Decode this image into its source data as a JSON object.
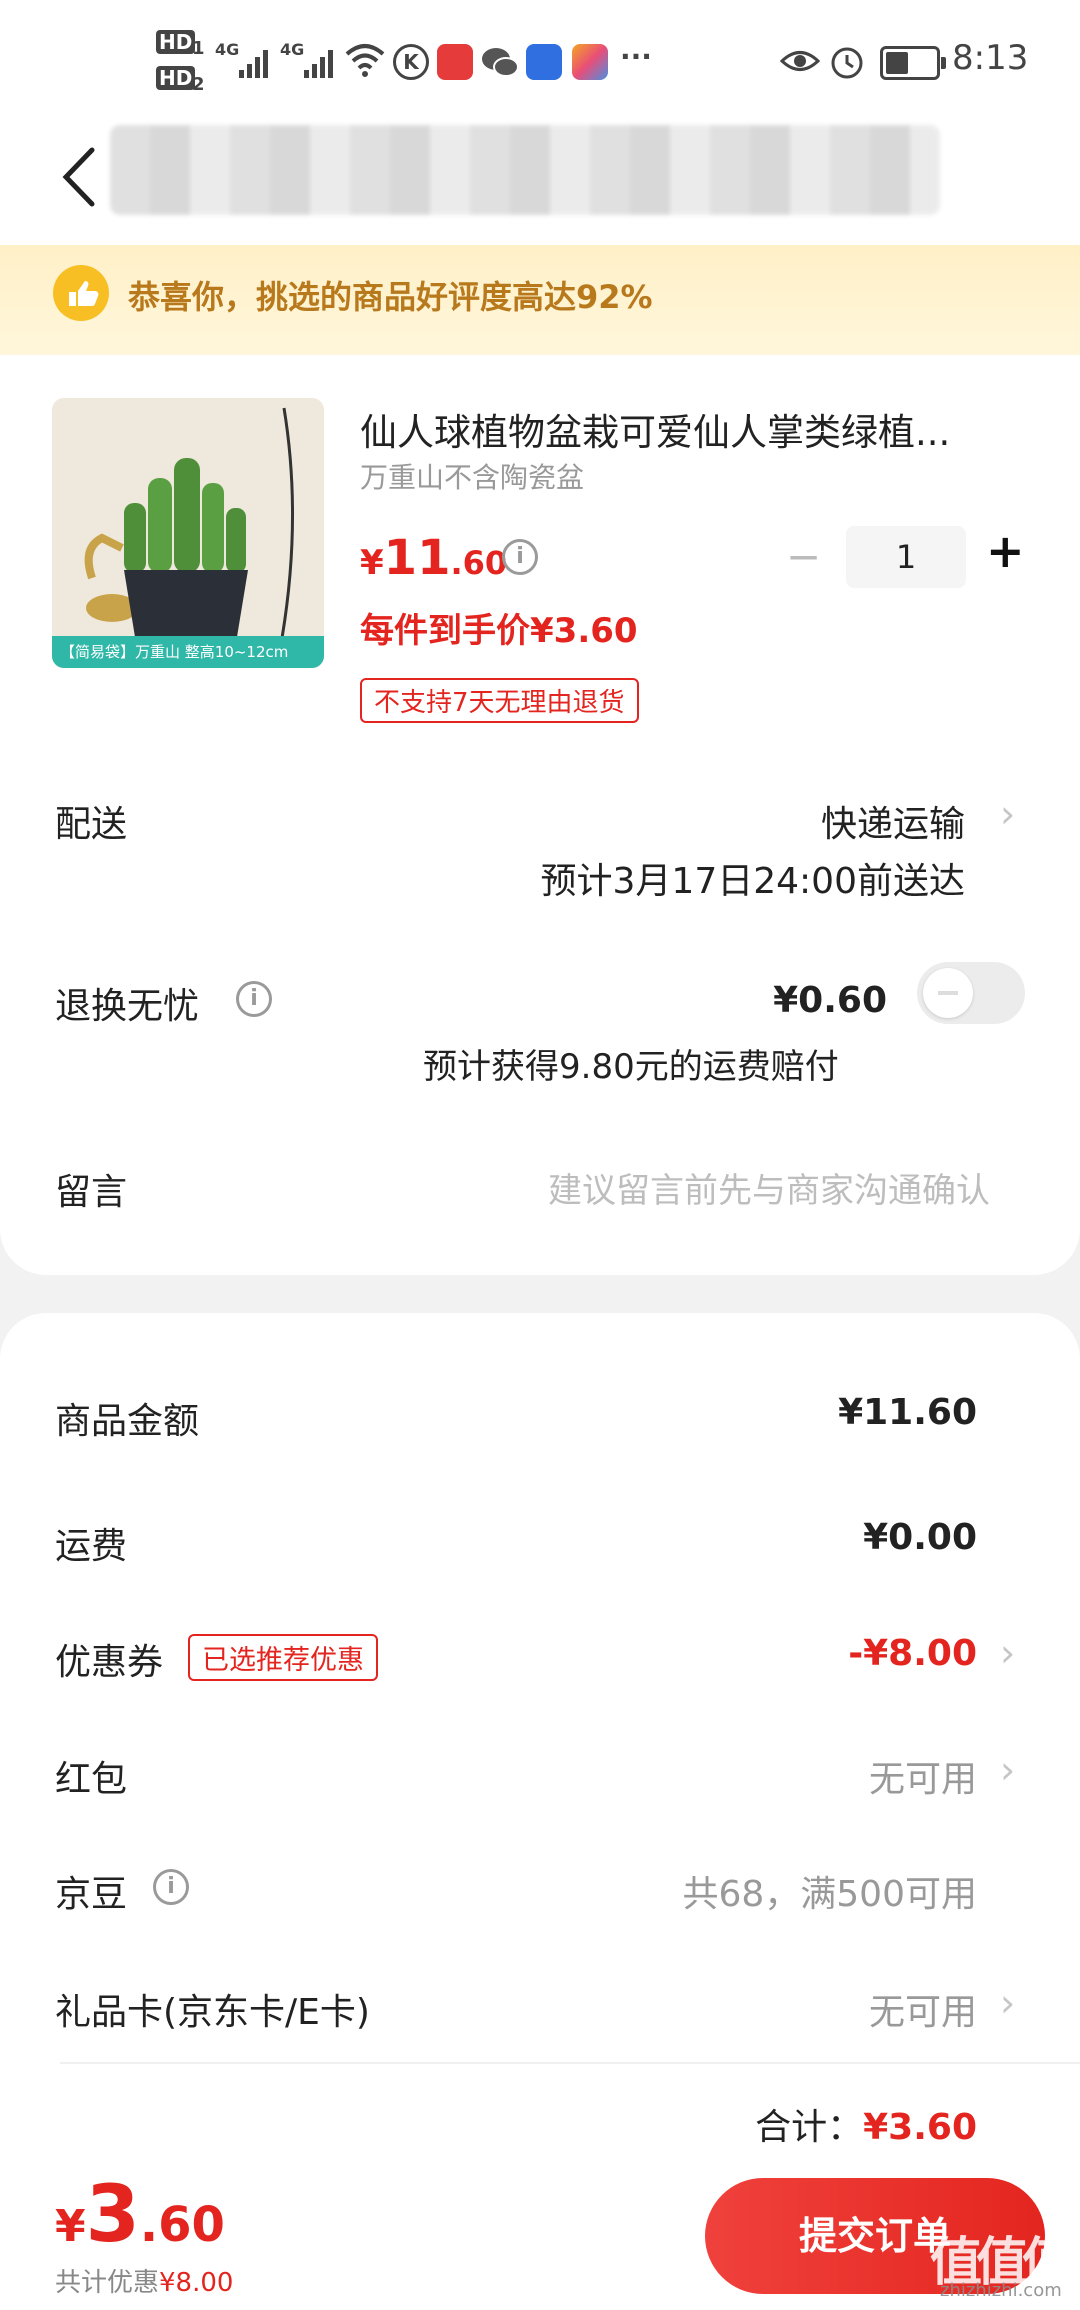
{
  "status_bar": {
    "hd1": "HD",
    "hd2": "HD",
    "sim1": "1",
    "sim2": "2",
    "net1": "4G",
    "net2": "4G",
    "more": "···",
    "time": "8:13"
  },
  "banner": {
    "text": "恭喜你，挑选的商品好评度高达92%"
  },
  "product": {
    "title": "仙人球植物盆栽可爱仙人掌类绿植...",
    "spec": "万重山不含陶瓷盆",
    "price_symbol": "¥",
    "price_int": "11",
    "price_dec": ".60",
    "final_price": "每件到手价¥3.60",
    "return_tag": "不支持7天无理由退货",
    "qty": "1",
    "minus": "−",
    "plus": "+",
    "image_caption": "【简易袋】万重山 整高10~12cm"
  },
  "delivery": {
    "label": "配送",
    "method": "快递运输",
    "eta": "预计3月17日24:00前送达"
  },
  "return_insurance": {
    "label": "退换无忧",
    "price": "¥0.60",
    "desc": "预计获得9.80元的运费赔付",
    "toggle_on": false
  },
  "message": {
    "label": "留言",
    "placeholder": "建议留言前先与商家沟通确认"
  },
  "summary": {
    "goods_label": "商品金额",
    "goods_value": "¥11.60",
    "shipping_label": "运费",
    "shipping_value": "¥0.00",
    "coupon_label": "优惠券",
    "coupon_tag": "已选推荐优惠",
    "coupon_value": "-¥8.00",
    "redpacket_label": "红包",
    "redpacket_value": "无可用",
    "jingdou_label": "京豆",
    "jingdou_value": "共68，满500可用",
    "giftcard_label": "礼品卡(京东卡/E卡)",
    "giftcard_value": "无可用",
    "total_label": "合计：",
    "total_value": "¥3.60"
  },
  "footer": {
    "price_symbol": "¥",
    "price_int": "3",
    "price_dec": ".60",
    "discount_label": "共计优惠",
    "discount_value": "¥8.00",
    "submit": "提交订单",
    "watermark": "值值值",
    "watermark_url": "zhizhizhi.com"
  },
  "colors": {
    "accent": "#e4251f",
    "banner_text": "#b8791c",
    "banner_bg": "#fff2cc"
  }
}
